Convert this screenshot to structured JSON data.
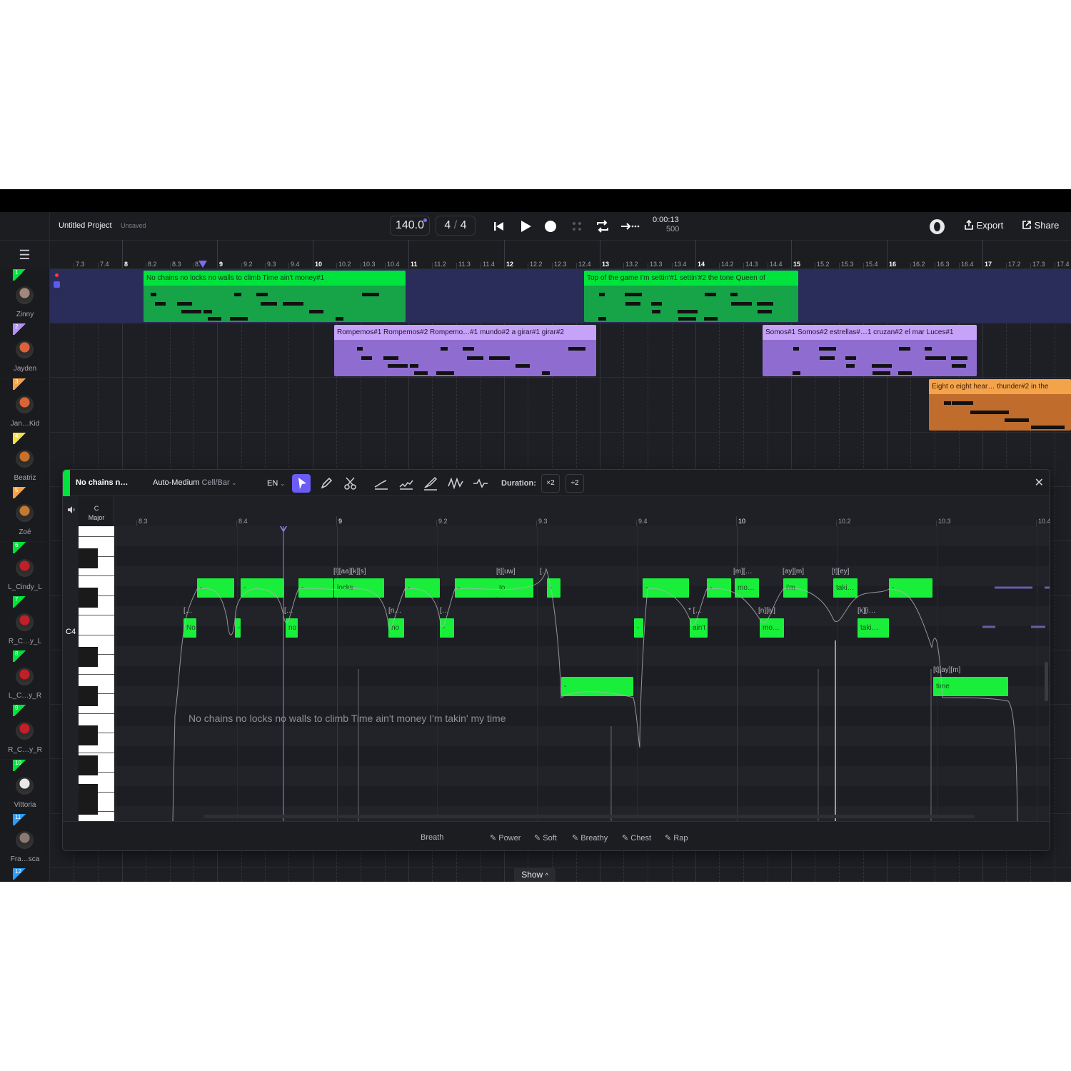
{
  "project": {
    "title": "Untitled Project",
    "status": "Unsaved"
  },
  "transport": {
    "bpm": "140.0",
    "sig_num": "4",
    "sig_sep": "/",
    "sig_den": "4",
    "time": "0:00:13",
    "ticks": "500"
  },
  "top_actions": {
    "export": "Export",
    "share": "Share"
  },
  "ruler": [
    "7.3",
    "7.4",
    "8",
    "8.2",
    "8.3",
    "8.",
    "9",
    "9.2",
    "9.3",
    "9.4",
    "10",
    "10.2",
    "10.3",
    "10.4",
    "11",
    "11.2",
    "11.3",
    "11.4",
    "12",
    "12.2",
    "12.3",
    "12.4",
    "13",
    "13.2",
    "13.3",
    "13.4",
    "14",
    "14.2",
    "14.3",
    "14.4",
    "15",
    "15.2",
    "15.3",
    "15.4",
    "16",
    "16.2",
    "16.3",
    "16.4",
    "17",
    "17.2",
    "17.3",
    "17.4"
  ],
  "tracks": [
    {
      "num": "1",
      "name": "Zinny",
      "color": "#00e33c"
    },
    {
      "num": "2",
      "name": "Jayden",
      "color": "#b392f0"
    },
    {
      "num": "3",
      "name": "Jan…Kid",
      "color": "#f5a34a"
    },
    {
      "num": "4",
      "name": "Beatriz",
      "color": "#f5e04a"
    },
    {
      "num": "5",
      "name": "Zoé",
      "color": "#f5a34a"
    },
    {
      "num": "6",
      "name": "L_Cindy_L",
      "color": "#00e33c"
    },
    {
      "num": "7",
      "name": "R_C…y_L",
      "color": "#00e33c"
    },
    {
      "num": "8",
      "name": "L_C…y_R",
      "color": "#00e33c"
    },
    {
      "num": "9",
      "name": "R_C…y_R",
      "color": "#00e33c"
    },
    {
      "num": "10",
      "name": "Vittoria",
      "color": "#00e33c"
    },
    {
      "num": "11",
      "name": "Fra…sca",
      "color": "#2f9cf5"
    },
    {
      "num": "12",
      "name": "",
      "color": "#2f9cf5"
    }
  ],
  "clips": [
    {
      "title": "No chains no locks no walls to climb Time ain't money#1"
    },
    {
      "title": "Top of the game I'm settin'#1 settin'#2 the tone Queen of"
    },
    {
      "title": "Rompemos#1 Rompemos#2 Rompemo…#1 mundo#2 a girar#1 girar#2"
    },
    {
      "title": "Somos#1 Somos#2 estrellas#…1 cruzan#2 el mar Luces#1"
    },
    {
      "title": "Eight o eight hear… thunder#2 in the"
    }
  ],
  "editor": {
    "title": "No chains n…",
    "mode": "Auto-Medium",
    "mode_unit": "Cell/Bar",
    "lang": "EN",
    "duration_label": "Duration:",
    "dur_x2": "×2",
    "dur_div2": "÷2",
    "key_root": "C",
    "key_mode": "Major",
    "c4": "C4",
    "ruler": [
      "8.3",
      "8.4",
      "9",
      "9.2",
      "9.3",
      "9.4",
      "10",
      "10.2",
      "10.3",
      "10.4"
    ],
    "lyric": "No chains no locks no walls to climb Time ain't money I'm takin' my time",
    "notes_hi": [
      "-",
      "-",
      "-",
      "locks",
      "-",
      "-",
      "to",
      "-",
      "-",
      "-",
      "mo…",
      "i'm",
      "taki…",
      "-"
    ],
    "notes_lo": [
      "No",
      "-",
      "no",
      "no",
      "-",
      "-",
      "ain't",
      "mo…",
      "taki…"
    ],
    "note_mid": "-",
    "note_time": "time",
    "phon_hi": [
      "[l][aa][k][s]",
      "[t][uw]",
      "[…",
      "[m][…",
      "[ay][m]",
      "[t][ey]"
    ],
    "phon_lo": [
      "[…",
      "[…",
      "[n…",
      "[…",
      "* […",
      "[n][iy]",
      "[k][i…"
    ],
    "phon_time": "[t][ay][m]",
    "bottom": {
      "breath": "Breath",
      "power": "Power",
      "soft": "Soft",
      "breathy": "Breathy",
      "chest": "Chest",
      "rap": "Rap"
    }
  },
  "show": "Show"
}
